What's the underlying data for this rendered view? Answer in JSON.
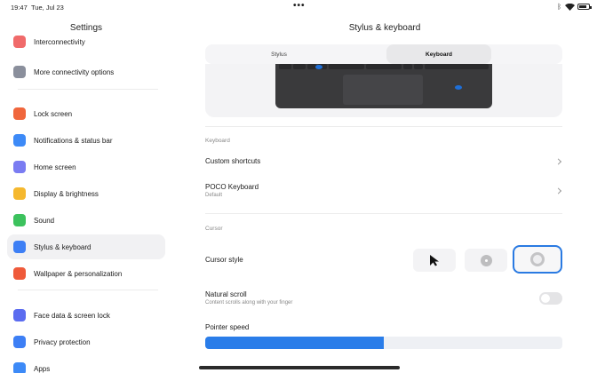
{
  "status_bar": {
    "time": "19:47",
    "date": "Tue, Jul 23",
    "dots": "•••"
  },
  "left_pane": {
    "title": "Settings",
    "items": [
      {
        "label": "Interconnectivity",
        "icon": "interconnectivity-icon",
        "color": "#f06a6a"
      },
      {
        "label": "More connectivity options",
        "icon": "link-icon",
        "color": "#8a8f9c"
      },
      {
        "label": "Lock screen",
        "icon": "lock-icon",
        "color": "#f0663c"
      },
      {
        "label": "Notifications & status bar",
        "icon": "notification-icon",
        "color": "#3d8af7"
      },
      {
        "label": "Home screen",
        "icon": "home-icon",
        "color": "#7a7cf2"
      },
      {
        "label": "Display & brightness",
        "icon": "sun-icon",
        "color": "#f5b82e"
      },
      {
        "label": "Sound",
        "icon": "sound-icon",
        "color": "#3cc25d"
      },
      {
        "label": "Stylus & keyboard",
        "icon": "keyboard-icon",
        "color": "#3d7ff5"
      },
      {
        "label": "Wallpaper & personalization",
        "icon": "wallpaper-icon",
        "color": "#ef5a3a"
      },
      {
        "label": "Face data & screen lock",
        "icon": "face-icon",
        "color": "#5b6cf0"
      },
      {
        "label": "Privacy protection",
        "icon": "privacy-icon",
        "color": "#3d7ff5"
      },
      {
        "label": "Apps",
        "icon": "apps-icon",
        "color": "#3d8af7"
      }
    ],
    "selected_index": 7
  },
  "right_pane": {
    "title": "Stylus & keyboard",
    "tabs": [
      {
        "label": "Stylus"
      },
      {
        "label": "Keyboard"
      }
    ],
    "active_tab": "Keyboard",
    "keyboard_section": {
      "label": "Keyboard",
      "custom_shortcuts": "Custom shortcuts",
      "poco_keyboard": "POCO Keyboard",
      "poco_keyboard_sub": "Default"
    },
    "cursor_section": {
      "label": "Cursor",
      "cursor_style": "Cursor style",
      "cursor_options": [
        "arrow-cursor-icon",
        "dot-cursor-icon",
        "ring-cursor-icon"
      ],
      "selected_cursor": 2,
      "natural_scroll": "Natural scroll",
      "natural_scroll_sub": "Content scrolls along with your finger",
      "natural_scroll_on": false,
      "pointer_speed": "Pointer speed",
      "pointer_speed_value": 0.5
    },
    "accent_color": "#2a7de9"
  }
}
